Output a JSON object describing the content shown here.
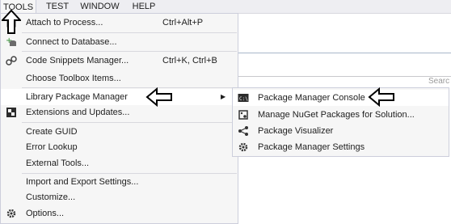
{
  "menubar": {
    "items": [
      {
        "label": "TOOLS"
      },
      {
        "label": "TEST"
      },
      {
        "label": "WINDOW"
      },
      {
        "label": "HELP"
      }
    ]
  },
  "tools_menu": {
    "items": [
      {
        "label": "Attach to Process...",
        "shortcut": "Ctrl+Alt+P",
        "icon": "attach-icon"
      },
      {
        "label": "Connect to Database...",
        "shortcut": "",
        "icon": "database-plus-icon"
      },
      {
        "label": "Code Snippets Manager...",
        "shortcut": "Ctrl+K, Ctrl+B",
        "icon": "snippets-icon"
      },
      {
        "label": "Choose Toolbox Items...",
        "shortcut": ""
      },
      {
        "label": "Library Package Manager",
        "shortcut": "",
        "submenu": true
      },
      {
        "label": "Extensions and Updates...",
        "shortcut": "",
        "icon": "extensions-icon"
      },
      {
        "label": "Create GUID",
        "shortcut": ""
      },
      {
        "label": "Error Lookup",
        "shortcut": ""
      },
      {
        "label": "External Tools...",
        "shortcut": ""
      },
      {
        "label": "Import and Export Settings...",
        "shortcut": ""
      },
      {
        "label": "Customize...",
        "shortcut": ""
      },
      {
        "label": "Options...",
        "shortcut": "",
        "icon": "gear-icon"
      }
    ]
  },
  "package_submenu": {
    "items": [
      {
        "label": "Package Manager Console",
        "icon": "console-icon"
      },
      {
        "label": "Manage NuGet Packages for Solution...",
        "icon": "nuget-icon"
      },
      {
        "label": "Package Visualizer",
        "icon": "visualizer-icon"
      },
      {
        "label": "Package Manager Settings",
        "icon": "gear-icon"
      }
    ]
  },
  "background": {
    "partial_text": "Searc"
  },
  "colors": {
    "menu_bg": "#f6f6f6",
    "menu_border": "#cccedb",
    "highlight": "#ffffff",
    "menubar_bg": "#eeeef2"
  }
}
